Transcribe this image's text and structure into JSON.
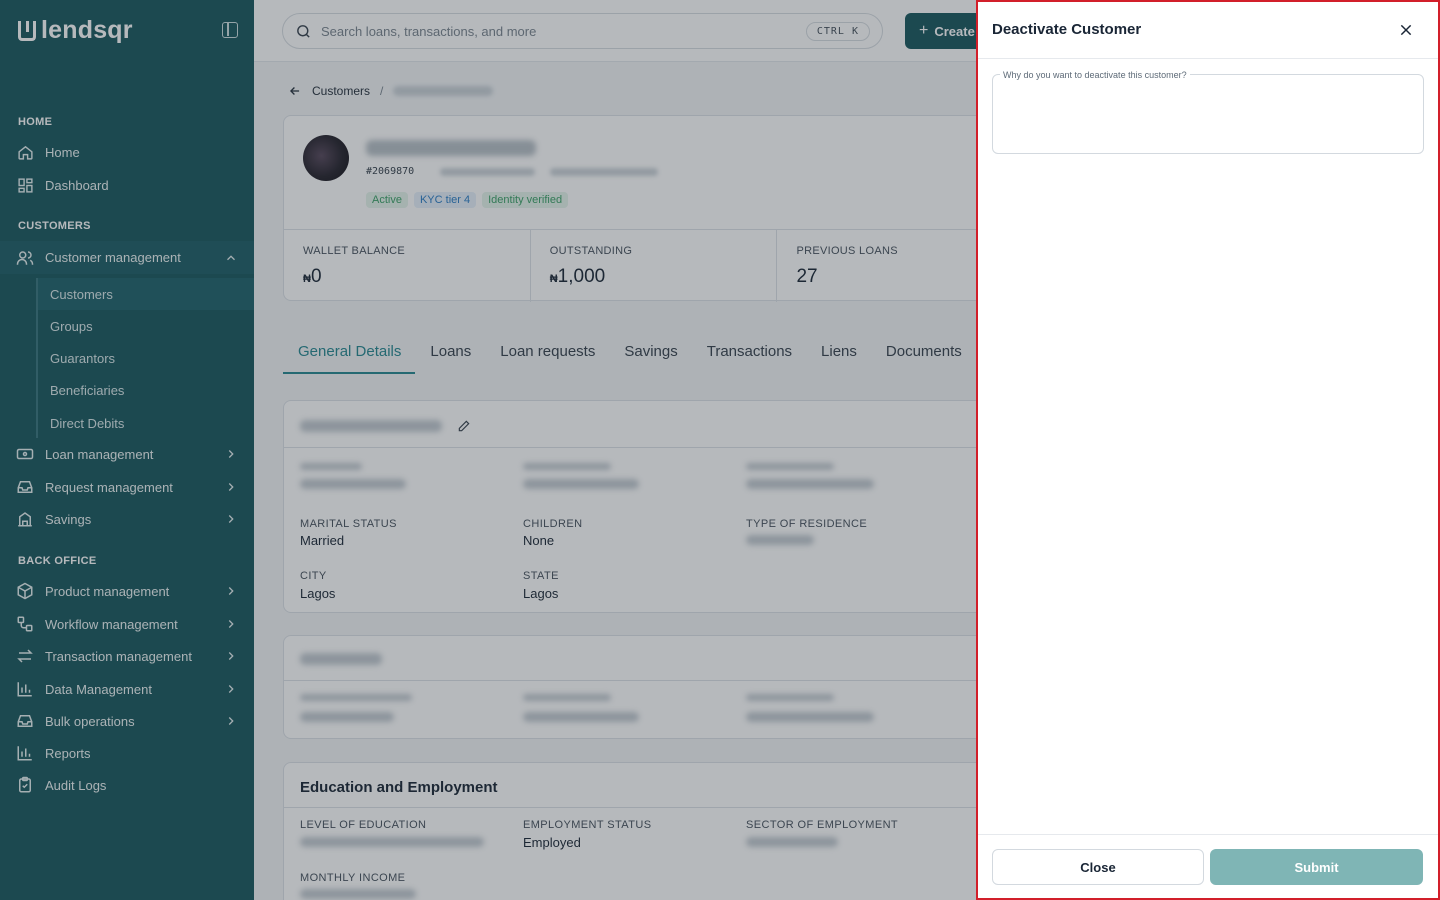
{
  "app": {
    "name": "lendsqr"
  },
  "sidebar": {
    "sections": {
      "home": "HOME",
      "customers": "CUSTOMERS",
      "back_office": "BACK OFFICE"
    },
    "home_items": [
      {
        "label": "Home",
        "icon": "home-icon"
      },
      {
        "label": "Dashboard",
        "icon": "dashboard-icon"
      }
    ],
    "customer_management": {
      "label": "Customer management",
      "icon": "users-icon",
      "expanded": true
    },
    "customer_sub_items": [
      "Customers",
      "Groups",
      "Guarantors",
      "Beneficiaries",
      "Direct Debits"
    ],
    "active_sub_item": "Customers",
    "customer_items": [
      {
        "label": "Loan management",
        "icon": "loan-icon"
      },
      {
        "label": "Request management",
        "icon": "inbox-icon"
      },
      {
        "label": "Savings",
        "icon": "savings-icon"
      }
    ],
    "back_office_items": [
      {
        "label": "Product management",
        "icon": "box-icon",
        "chevron": true
      },
      {
        "label": "Workflow management",
        "icon": "workflow-icon",
        "chevron": true
      },
      {
        "label": "Transaction management",
        "icon": "transfer-icon",
        "chevron": true
      },
      {
        "label": "Data Management",
        "icon": "chart-icon",
        "chevron": true
      },
      {
        "label": "Bulk operations",
        "icon": "inbox-icon",
        "chevron": true
      },
      {
        "label": "Reports",
        "icon": "chart-icon",
        "chevron": false
      },
      {
        "label": "Audit Logs",
        "icon": "clipboard-icon",
        "chevron": false
      }
    ]
  },
  "topbar": {
    "search_placeholder": "Search loans, transactions, and more",
    "shortcut": "CTRL K",
    "create_label": "Create"
  },
  "breadcrumb": {
    "root": "Customers"
  },
  "profile": {
    "customer_id": "#2069870",
    "badges": [
      {
        "label": "Active",
        "tone": "green"
      },
      {
        "label": "KYC tier 4",
        "tone": "blue"
      },
      {
        "label": "Identity verified",
        "tone": "green"
      }
    ],
    "stats": [
      {
        "label": "WALLET BALANCE",
        "currency": "₦",
        "value": "0"
      },
      {
        "label": "OUTSTANDING",
        "currency": "₦",
        "value": "1,000"
      },
      {
        "label": "PREVIOUS LOANS",
        "currency": "",
        "value": "27"
      }
    ]
  },
  "tabs": [
    "General Details",
    "Loans",
    "Loan requests",
    "Savings",
    "Transactions",
    "Liens",
    "Documents"
  ],
  "active_tab": "General Details",
  "personal": {
    "fields": [
      {
        "label": "MARITAL STATUS",
        "value": "Married"
      },
      {
        "label": "CHILDREN",
        "value": "None"
      },
      {
        "label": "TYPE OF RESIDENCE",
        "value": ""
      },
      {
        "label": "CITY",
        "value": "Lagos"
      },
      {
        "label": "STATE",
        "value": "Lagos"
      }
    ]
  },
  "education": {
    "title": "Education and Employment",
    "fields": [
      {
        "label": "LEVEL OF EDUCATION",
        "value": ""
      },
      {
        "label": "EMPLOYMENT STATUS",
        "value": "Employed"
      },
      {
        "label": "SECTOR OF EMPLOYMENT",
        "value": ""
      },
      {
        "label": "MONTHLY INCOME",
        "value": ""
      }
    ]
  },
  "drawer": {
    "title": "Deactivate Customer",
    "reason_label": "Why do you want to deactivate this customer?",
    "reason_value": "",
    "close_label": "Close",
    "submit_label": "Submit"
  },
  "colors": {
    "brand": "#1d5a61",
    "accent": "#2a8a93",
    "submit_disabled": "#7fb5b5",
    "highlight_border": "#d21f2a"
  }
}
